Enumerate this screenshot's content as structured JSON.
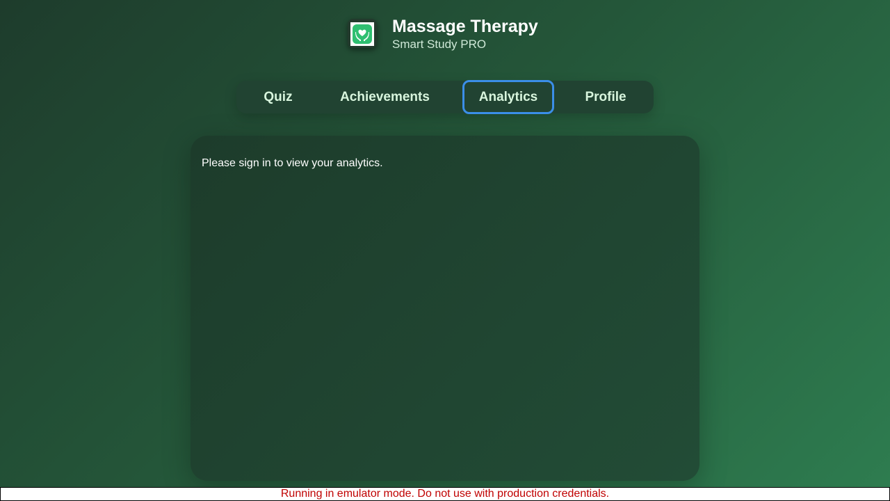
{
  "header": {
    "title": "Massage Therapy",
    "subtitle": "Smart Study PRO",
    "logo_icon": "hands-holding-heart-icon",
    "accent_color": "#2fbf71"
  },
  "nav": {
    "tabs": [
      {
        "label": "Quiz",
        "active": false
      },
      {
        "label": "Achievements",
        "active": false
      },
      {
        "label": "Analytics",
        "active": true
      },
      {
        "label": "Profile",
        "active": false
      }
    ],
    "focus_color": "#3b8ee8"
  },
  "main": {
    "message": "Please sign in to view your analytics."
  },
  "footer": {
    "emulator_warning": "Running in emulator mode. Do not use with production credentials.",
    "warning_color": "#c00000"
  }
}
